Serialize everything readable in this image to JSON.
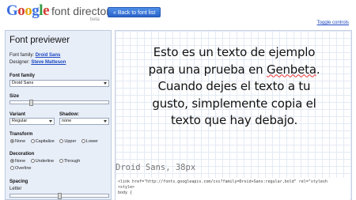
{
  "header": {
    "logo_google": "Google",
    "logo_title": "font directory",
    "logo_beta": "beta",
    "back_button": "« Back to font list",
    "toggle_controls": "Toggle controls"
  },
  "panel": {
    "title": "Font previewer",
    "font_family_label": "Font family:",
    "font_family_value": "Droid Sans",
    "designer_label": "Designer:",
    "designer_value": "Steve Matteson",
    "font_family_section": "Font family",
    "font_family_select": "Droid Sans",
    "size_label": "Size",
    "size_level": 0.2,
    "variant_label": "Variant",
    "variant_value": "Regular",
    "shadow_label": "Shadow:",
    "shadow_value": "none",
    "transform_label": "Transform",
    "transform_options": [
      "None",
      "Capitalize",
      "Upper",
      "Lower"
    ],
    "transform_selected": "None",
    "decoration_label": "Decoration",
    "decoration_options": [
      "None",
      "Underline",
      "Through",
      "Overline"
    ],
    "decoration_selected": "None",
    "spacing_label": "Spacing",
    "letter_label": "Letter"
  },
  "preview": {
    "text_line1": "Esto es un texto de ejemplo",
    "text_line2_pre": "para una prueba en ",
    "text_line2_word": "Genbeta",
    "text_line2_post": ".",
    "text_line3": "Cuando dejes el texto a tu",
    "text_line4": "gusto, simplemente copia el",
    "text_line5": "texto que hay debajo.",
    "caption": "Droid Sans, 38px",
    "code_line1": "<link href=\"http://fonts.googleapis.com/css?family=Droid+Sans:regular,bold\" rel=\"stylesh",
    "code_line2": "<style>",
    "code_line3": "body {"
  },
  "colors": {
    "accent": "#2a63c9",
    "link": "#1b46c2",
    "panel_bg": "#e8eef8"
  }
}
